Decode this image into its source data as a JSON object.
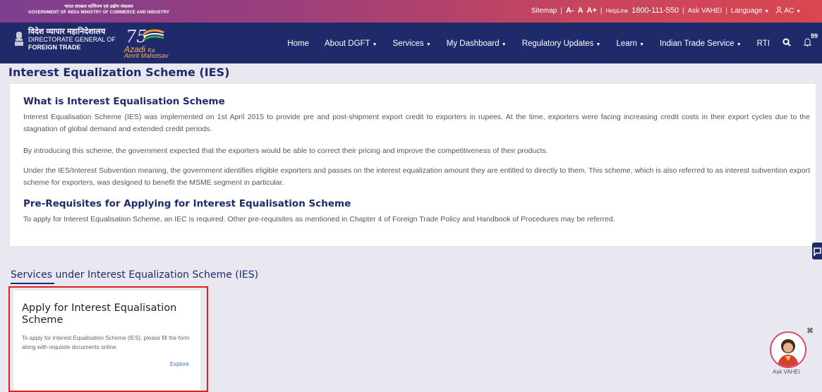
{
  "topbar": {
    "gov_hindi": "भारत सरकार  वाणिज्य एवं उद्योग मंत्रालय",
    "gov_english": "GOVERNMENT OF INDIA  MINISTRY OF COMMERCE AND INDUSTRY",
    "sitemap": "Sitemap",
    "font_small": "A-",
    "font_normal": "A",
    "font_large": "A+",
    "helpline_label": "HelpLine",
    "helpline_number": "1800-111-550",
    "ask_vahei": "Ask VAHEI",
    "language": "Language",
    "user": "AC"
  },
  "brand": {
    "hindi": "विदेश व्यापार महानिदेशालय",
    "line1": "DIRECTORATE GENERAL OF",
    "line2": "FOREIGN TRADE",
    "azadi1": "Azadi",
    "azadi_ka": "Ka",
    "azadi2": "Amrit Mahotsav"
  },
  "nav": {
    "home": "Home",
    "about": "About DGFT",
    "services": "Services",
    "dashboard": "My Dashboard",
    "regulatory": "Regulatory Updates",
    "learn": "Learn",
    "indian_trade": "Indian Trade Service",
    "rti": "RTI",
    "notif_count": "99"
  },
  "page": {
    "title": "Interest Equalization Scheme (IES)"
  },
  "content": {
    "h1": "What is Interest Equalisation Scheme",
    "p1": "Interest Equalisation Scheme (IES) was implemented on 1st April 2015 to provide pre and post-shipment export credit to exporters in rupees. At the time, exporters were facing increasing credit costs in their export cycles due to the stagnation of global demand and extended credit periods.",
    "p2": "By introducing this scheme, the government expected that the exporters would be able to correct their pricing and improve the competitiveness of their products.",
    "p3": "Under the IES/Interest Subvention meaning, the government identifies eligible exporters and passes on the interest equalization amount they are entitled to directly to them. This scheme, which is also referred to as interest subvention export scheme for exporters, was designed to benefit the MSME segment in particular.",
    "h2": "Pre-Requisites for Applying for Interest Equalisation Scheme",
    "p4": "To apply for Interest Equalisation Scheme, an IEC is required. Other pre-requisites as mentioned in Chapter 4 of Foreign Trade Policy and Handbook of Procedures may be referred."
  },
  "services": {
    "heading": "Services under Interest Equalization Scheme (IES)",
    "tile": {
      "title": "Apply for Interest Equalisation Scheme",
      "desc": "To apply for Interest Equalisation Scheme (IES), please fill the form along with requisite documents online.",
      "link": "Explore"
    }
  },
  "assistant": {
    "label": "Ask VAHEI"
  },
  "colors": {
    "navy": "#1f2a6b",
    "topbar_start": "#7e3f8f",
    "topbar_end": "#d9474f",
    "highlight": "#e02020"
  }
}
